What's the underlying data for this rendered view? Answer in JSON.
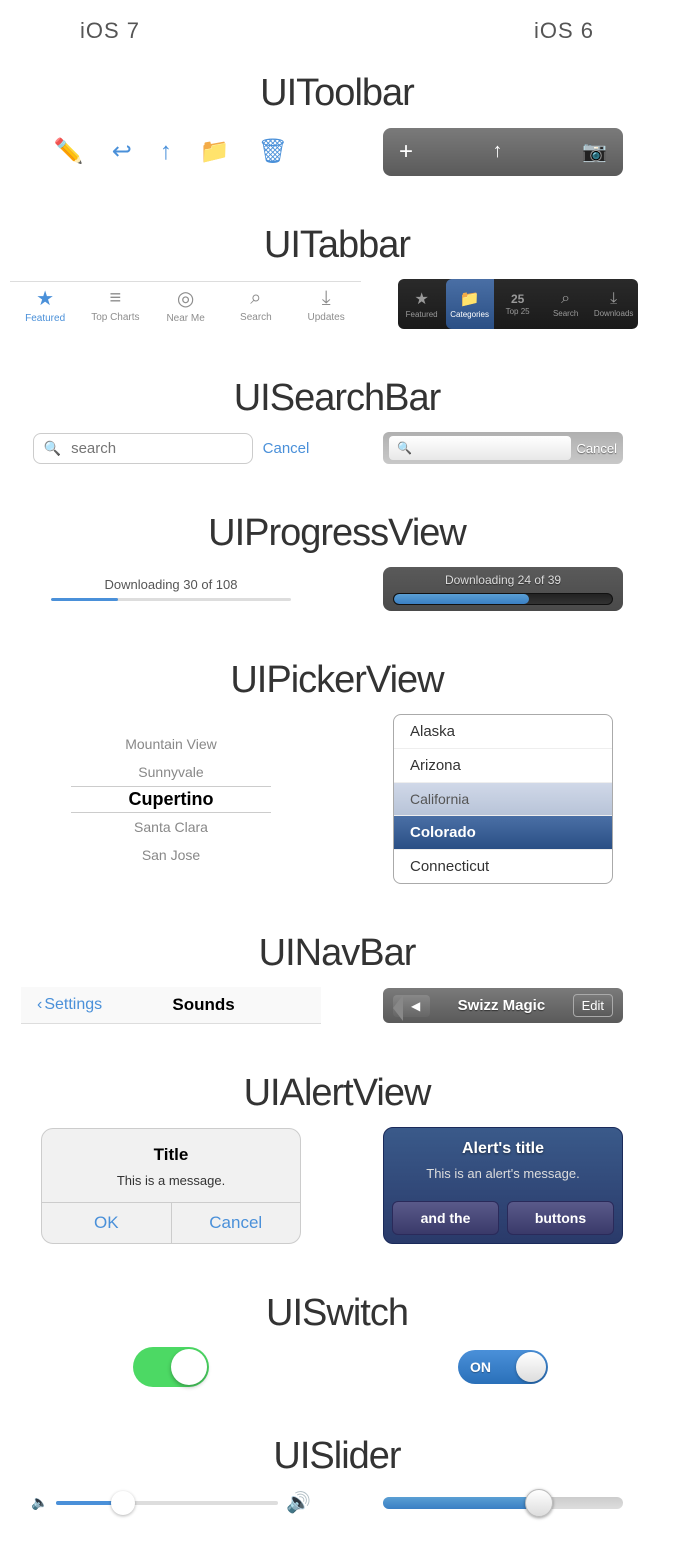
{
  "header": {
    "ios7_label": "iOS 7",
    "ios6_label": "iOS 6"
  },
  "sections": {
    "toolbar": {
      "title": "UIToolbar"
    },
    "tabbar": {
      "title": "UITabbar"
    },
    "searchbar": {
      "title": "UISearchBar"
    },
    "progressview": {
      "title": "UIProgressView"
    },
    "pickerview": {
      "title": "UIPickerView"
    },
    "navbar": {
      "title": "UINavBar"
    },
    "alertview": {
      "title": "UIAlertView"
    },
    "uiswitch": {
      "title": "UISwitch"
    },
    "uislider": {
      "title": "UISlider"
    }
  },
  "toolbar": {
    "ios7": {
      "icons": [
        "✏️",
        "↩",
        "↑",
        "📁",
        "🗑"
      ]
    },
    "ios6": {
      "icons": [
        "+",
        "↑",
        "📷"
      ]
    }
  },
  "tabbar": {
    "ios7": {
      "items": [
        {
          "label": "Featured",
          "icon": "★",
          "active": true
        },
        {
          "label": "Top Charts",
          "icon": "≡"
        },
        {
          "label": "Near Me",
          "icon": "◎"
        },
        {
          "label": "Search",
          "icon": "⌕"
        },
        {
          "label": "Updates",
          "icon": "⤓"
        }
      ]
    },
    "ios6": {
      "items": [
        {
          "label": "Featured",
          "icon": "★"
        },
        {
          "label": "Categories",
          "icon": "📁",
          "active": true
        },
        {
          "label": "Top 25",
          "icon": "25"
        },
        {
          "label": "Search",
          "icon": "⌕"
        },
        {
          "label": "Downloads",
          "icon": "⤓"
        }
      ]
    }
  },
  "searchbar": {
    "ios7": {
      "placeholder": "search",
      "cancel_label": "Cancel"
    },
    "ios6": {
      "placeholder": "",
      "cancel_label": "Cancel"
    }
  },
  "progressview": {
    "ios7": {
      "label": "Downloading 30 of 108",
      "progress": 28
    },
    "ios6": {
      "label": "Downloading 24 of 39",
      "progress": 62
    }
  },
  "pickerview": {
    "ios7": {
      "items": [
        "Mountain View",
        "Sunnyvale",
        "Cupertino",
        "Santa Clara",
        "San Jose"
      ],
      "selected": "Cupertino"
    },
    "ios6": {
      "items": [
        "Alaska",
        "Arizona",
        "California",
        "Colorado",
        "Connecticut"
      ],
      "selected": "Colorado"
    }
  },
  "navbar": {
    "ios7": {
      "back_label": "Settings",
      "title": "Sounds"
    },
    "ios6": {
      "back_label": "◀",
      "title": "Swizz Magic",
      "edit_label": "Edit"
    }
  },
  "alertview": {
    "ios7": {
      "title": "Title",
      "message": "This is a message.",
      "ok_label": "OK",
      "cancel_label": "Cancel"
    },
    "ios6": {
      "title": "Alert's title",
      "message": "This is an alert's message.",
      "btn1_label": "and the",
      "btn2_label": "buttons"
    }
  },
  "uiswitch": {
    "ios7": {
      "state": "ON"
    },
    "ios6": {
      "label": "ON"
    }
  },
  "uislider": {
    "ios7": {
      "min_icon": "🔈",
      "max_icon": "🔊"
    },
    "ios6": {}
  }
}
